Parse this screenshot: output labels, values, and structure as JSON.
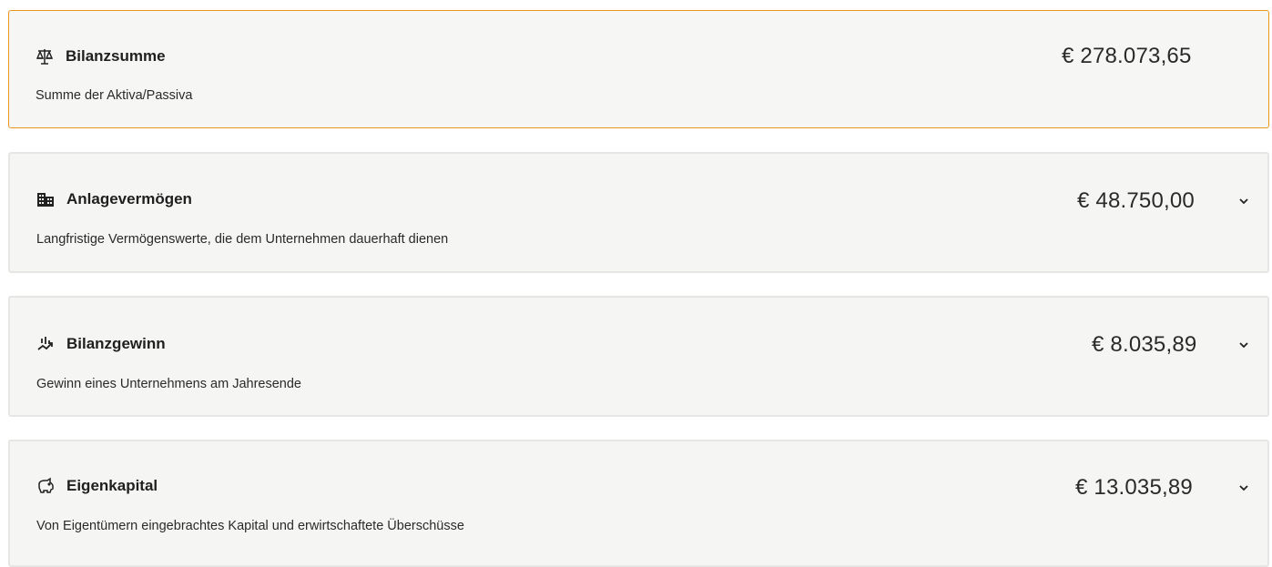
{
  "cards": [
    {
      "icon": "balance-scale-icon",
      "title": "Bilanzsumme",
      "amount": "€ 278.073,65",
      "description": "Summe der Aktiva/Passiva",
      "expandable": false,
      "highlighted": true
    },
    {
      "icon": "buildings-icon",
      "title": "Anlagevermögen",
      "amount": "€ 48.750,00",
      "description": "Langfristige Vermögenswerte, die dem Unternehmen dauerhaft dienen",
      "expandable": true,
      "highlighted": false
    },
    {
      "icon": "chart-trend-icon",
      "title": "Bilanzgewinn",
      "amount": "€ 8.035,89",
      "description": "Gewinn eines Unternehmens am Jahresende",
      "expandable": true,
      "highlighted": false
    },
    {
      "icon": "piggy-bank-icon",
      "title": "Eigenkapital",
      "amount": "€ 13.035,89",
      "description": "Von Eigentümern eingebrachtes Kapital und erwirtschaftete Überschüsse",
      "expandable": true,
      "highlighted": false
    }
  ],
  "colors": {
    "highlight_border": "#e8961e",
    "card_background": "#f5f5f4"
  }
}
